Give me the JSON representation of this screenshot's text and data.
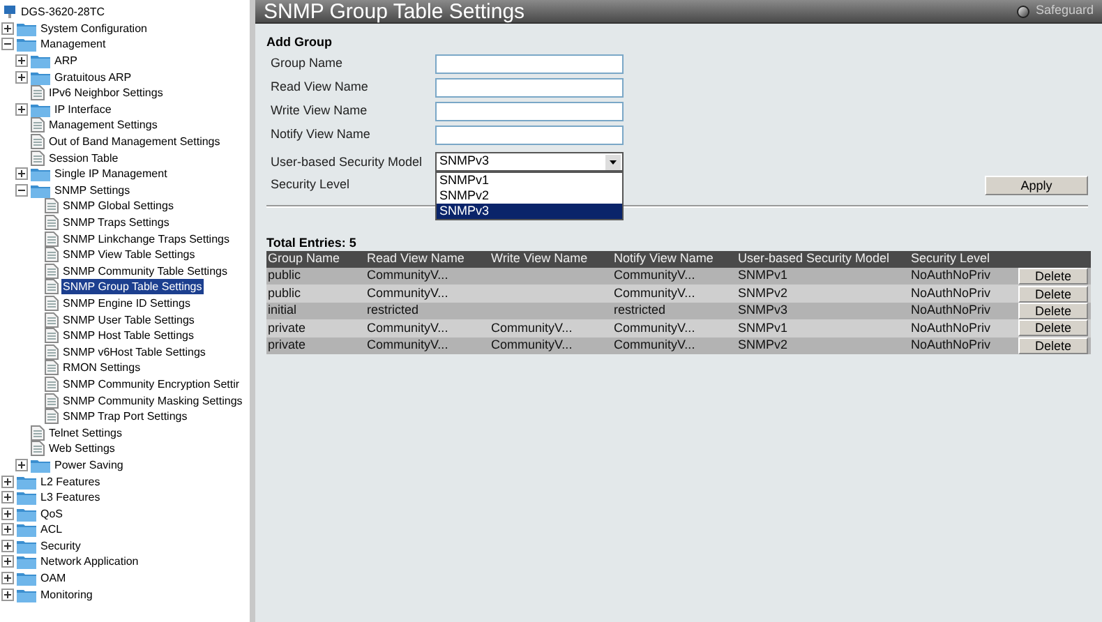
{
  "tree": {
    "label": "DGS-3620-28TC",
    "children": [
      {
        "label": "System Configuration",
        "kind": "folder",
        "expanded": false,
        "selected": false
      },
      {
        "label": "Management",
        "kind": "folder",
        "expanded": true,
        "selected": false,
        "children": [
          {
            "label": "ARP",
            "kind": "folder",
            "expanded": false,
            "selected": false
          },
          {
            "label": "Gratuitous ARP",
            "kind": "folder",
            "expanded": false,
            "selected": false
          },
          {
            "label": "IPv6 Neighbor Settings",
            "kind": "page",
            "selected": false
          },
          {
            "label": "IP Interface",
            "kind": "folder",
            "expanded": false,
            "selected": false
          },
          {
            "label": "Management Settings",
            "kind": "page",
            "selected": false
          },
          {
            "label": "Out of Band Management Settings",
            "kind": "page",
            "selected": false
          },
          {
            "label": "Session Table",
            "kind": "page",
            "selected": false
          },
          {
            "label": "Single IP Management",
            "kind": "folder",
            "expanded": false,
            "selected": false
          },
          {
            "label": "SNMP Settings",
            "kind": "folder",
            "expanded": true,
            "selected": false,
            "children": [
              {
                "label": "SNMP Global Settings",
                "kind": "page",
                "selected": false
              },
              {
                "label": "SNMP Traps Settings",
                "kind": "page",
                "selected": false
              },
              {
                "label": "SNMP Linkchange Traps Settings",
                "kind": "page",
                "selected": false
              },
              {
                "label": "SNMP View Table Settings",
                "kind": "page",
                "selected": false
              },
              {
                "label": "SNMP Community Table Settings",
                "kind": "page",
                "selected": false
              },
              {
                "label": "SNMP Group Table Settings",
                "kind": "page",
                "selected": true
              },
              {
                "label": "SNMP Engine ID Settings",
                "kind": "page",
                "selected": false
              },
              {
                "label": "SNMP User Table Settings",
                "kind": "page",
                "selected": false
              },
              {
                "label": "SNMP Host Table Settings",
                "kind": "page",
                "selected": false
              },
              {
                "label": "SNMP v6Host Table Settings",
                "kind": "page",
                "selected": false
              },
              {
                "label": "RMON Settings",
                "kind": "page",
                "selected": false
              },
              {
                "label": "SNMP Community Encryption Settir",
                "kind": "page",
                "selected": false
              },
              {
                "label": "SNMP Community Masking Settings",
                "kind": "page",
                "selected": false
              },
              {
                "label": "SNMP Trap Port Settings",
                "kind": "page",
                "selected": false
              }
            ]
          },
          {
            "label": "Telnet Settings",
            "kind": "page",
            "selected": false
          },
          {
            "label": "Web Settings",
            "kind": "page",
            "selected": false
          },
          {
            "label": "Power Saving",
            "kind": "folder",
            "expanded": false,
            "selected": false
          }
        ]
      },
      {
        "label": "L2 Features",
        "kind": "folder",
        "expanded": false,
        "selected": false
      },
      {
        "label": "L3 Features",
        "kind": "folder",
        "expanded": false,
        "selected": false
      },
      {
        "label": "QoS",
        "kind": "folder",
        "expanded": false,
        "selected": false
      },
      {
        "label": "ACL",
        "kind": "folder",
        "expanded": false,
        "selected": false
      },
      {
        "label": "Security",
        "kind": "folder",
        "expanded": false,
        "selected": false
      },
      {
        "label": "Network Application",
        "kind": "folder",
        "expanded": false,
        "selected": false
      },
      {
        "label": "OAM",
        "kind": "folder",
        "expanded": false,
        "selected": false
      },
      {
        "label": "Monitoring",
        "kind": "folder",
        "expanded": false,
        "selected": false
      }
    ]
  },
  "header": {
    "title": "SNMP Group Table Settings",
    "safeguard": "Safeguard"
  },
  "form": {
    "heading": "Add Group",
    "fields": [
      {
        "label": "Group Name"
      },
      {
        "label": "Read View Name"
      },
      {
        "label": "Write View Name"
      },
      {
        "label": "Notify View Name"
      }
    ],
    "model": {
      "label": "User-based Security Model",
      "value": "SNMPv3",
      "options": [
        {
          "label": "SNMPv1",
          "selected": false
        },
        {
          "label": "SNMPv2",
          "selected": false
        },
        {
          "label": "SNMPv3",
          "selected": true
        }
      ]
    },
    "level": {
      "label": "Security Level"
    },
    "apply": "Apply"
  },
  "table": {
    "total": "Total Entries: 5",
    "columns": [
      "Group Name",
      "Read View Name",
      "Write View Name",
      "Notify View Name",
      "User-based Security Model",
      "Security Level"
    ],
    "rows": [
      {
        "cells": [
          "public",
          "CommunityV...",
          "",
          "CommunityV...",
          "SNMPv1",
          "NoAuthNoPriv"
        ],
        "action": "Delete"
      },
      {
        "cells": [
          "public",
          "CommunityV...",
          "",
          "CommunityV...",
          "SNMPv2",
          "NoAuthNoPriv"
        ],
        "action": "Delete"
      },
      {
        "cells": [
          "initial",
          "restricted",
          "",
          "restricted",
          "SNMPv3",
          "NoAuthNoPriv"
        ],
        "action": "Delete"
      },
      {
        "cells": [
          "private",
          "CommunityV...",
          "CommunityV...",
          "CommunityV...",
          "SNMPv1",
          "NoAuthNoPriv"
        ],
        "action": "Delete"
      },
      {
        "cells": [
          "private",
          "CommunityV...",
          "CommunityV...",
          "CommunityV...",
          "SNMPv2",
          "NoAuthNoPriv"
        ],
        "action": "Delete"
      }
    ]
  }
}
